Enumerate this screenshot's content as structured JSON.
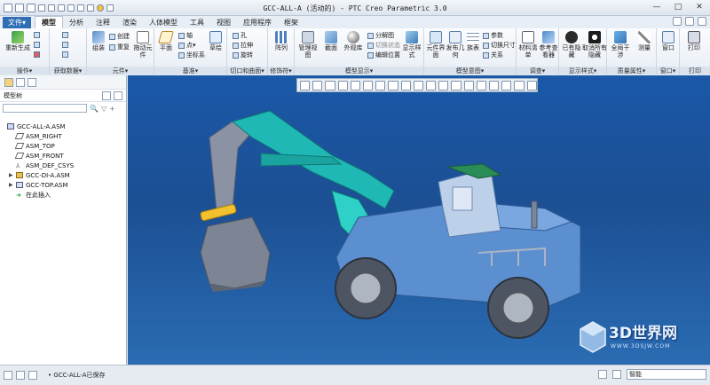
{
  "window": {
    "title": "GCC-ALL-A (活动的) - PTC Creo Parametric 3.0",
    "controls": [
      "—",
      "□",
      "✕"
    ]
  },
  "menubar": {
    "file_label": "文件▾",
    "tabs": [
      "模型",
      "分析",
      "注释",
      "渲染",
      "人体模型",
      "工具",
      "视图",
      "应用程序",
      "框架"
    ]
  },
  "ribbon": {
    "groups": [
      {
        "label": "操作▾"
      },
      {
        "label": "获取数据▾"
      },
      {
        "label": "元件▾"
      },
      {
        "label": "基准▾"
      },
      {
        "label": "切口和曲面▾"
      },
      {
        "label": "修饰符▾"
      },
      {
        "label": "模型显示▾"
      },
      {
        "label": "模型意图▾"
      },
      {
        "label": "调查▾"
      },
      {
        "label": "显示样式▾"
      },
      {
        "label": "质量属性▾"
      },
      {
        "label": "窗口▾"
      },
      {
        "label": "打印"
      }
    ],
    "buttons": {
      "regenerate": "重新生成",
      "assemble": "组装",
      "create": "创建",
      "repeat": "重复",
      "drag": "拖动元件",
      "plane": "平面",
      "axis": "轴",
      "point": "点▾",
      "csys": "坐标系",
      "sketch": "草绘",
      "hole": "孔",
      "extrude": "拉伸",
      "revolve": "旋转",
      "pattern": "阵列",
      "manage_views": "管理视图",
      "section": "截面",
      "appearance": "外观库",
      "explode": "分解图",
      "toggle_state": "切换状态",
      "edit_position": "编辑位置",
      "display_style": "显示样式",
      "element_interface": "元件界面",
      "publish_geom": "发布几何",
      "family_table": "族表",
      "params": "参数",
      "switch_dims": "切换尺寸",
      "relations": "关系",
      "bom": "材料清单",
      "ref_viewer": "参考查看器",
      "hide": "已有隐藏",
      "unhide": "取消所有隐藏",
      "global_interference": "全局干涉",
      "measure": "测量",
      "window": "窗口",
      "print": "打印"
    }
  },
  "model_tree": {
    "header": "模型树",
    "items": [
      {
        "label": "GCC-ALL-A.ASM",
        "type": "root"
      },
      {
        "label": "ASM_RIGHT",
        "type": "plane"
      },
      {
        "label": "ASM_TOP",
        "type": "plane"
      },
      {
        "label": "ASM_FRONT",
        "type": "plane"
      },
      {
        "label": "ASM_DEF_CSYS",
        "type": "csys"
      },
      {
        "label": "GCC-DI-A.ASM",
        "type": "asm"
      },
      {
        "label": "GCC-TOP.ASM",
        "type": "asm"
      },
      {
        "label": "在此插入",
        "type": "insert"
      }
    ]
  },
  "statusbar": {
    "message": "• GCC-ALL-A已保存",
    "filter": "智能"
  },
  "watermark": {
    "brand": "3D世界网",
    "url": "WWW.3DSJW.COM"
  },
  "colors": {
    "accent": "#2f6db5",
    "background_top": "#1a58a8",
    "teal": "#1fb8b4",
    "body_blue": "#5b8fd0",
    "cab_green": "#2a8c57",
    "bucket_grey": "#7d8594"
  }
}
